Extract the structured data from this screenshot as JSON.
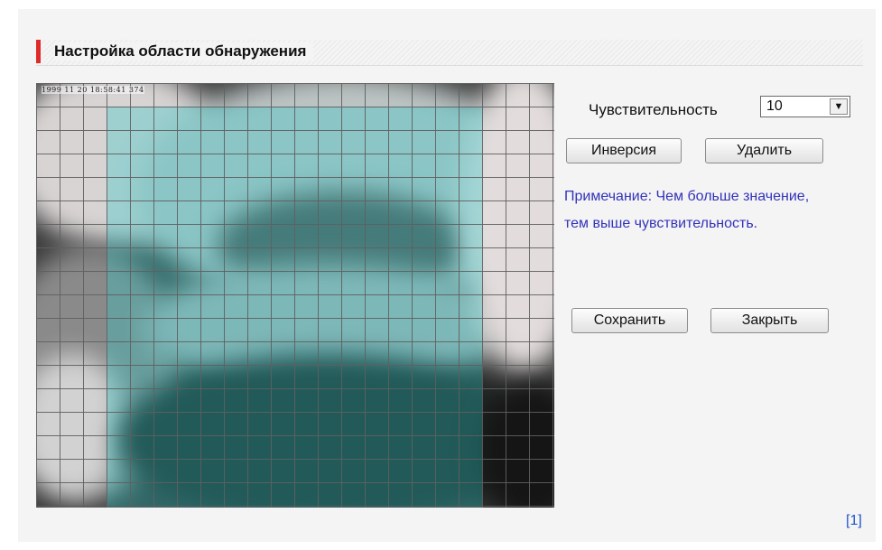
{
  "page": {
    "title": "Настройка области обнаружения"
  },
  "camera": {
    "timestamp": "1999 11 20 18:58:41 374"
  },
  "sensitivity": {
    "label": "Чувствительность",
    "value": "10"
  },
  "buttons": {
    "invert": "Инверсия",
    "delete": "Удалить",
    "save": "Сохранить",
    "close": "Закрыть"
  },
  "note": {
    "line1": "Примечание: Чем больше значение,",
    "line2": "тем выше чувствительность."
  },
  "footer": {
    "link": "[1]"
  },
  "colors": {
    "title_marker": "#e02a2a",
    "note_text": "#3333bb",
    "link": "#2255cc",
    "selection": "#28c8c8"
  }
}
